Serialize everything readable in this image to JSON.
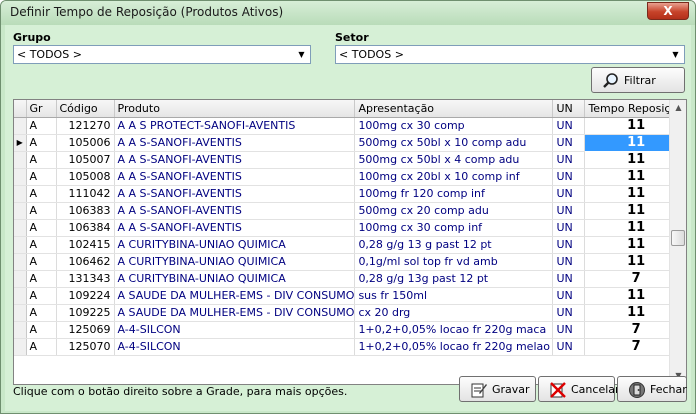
{
  "window": {
    "title": "Definir Tempo de Reposição (Produtos Ativos)",
    "close_label": "X"
  },
  "filters": {
    "grupo_label": "Grupo",
    "grupo_value": "< TODOS >",
    "setor_label": "Setor",
    "setor_value": "< TODOS >",
    "filtrar_label": "Filtrar"
  },
  "grid": {
    "columns": [
      "Gr",
      "Código",
      "Produto",
      "Apresentação",
      "UN",
      "Tempo Reposição"
    ],
    "rows": [
      {
        "gr": "A",
        "codigo": "121270",
        "produto": "A A S PROTECT-SANOFI-AVENTIS",
        "apresentacao": "100mg cx 30 comp",
        "un": "UN",
        "tempo": "11"
      },
      {
        "gr": "A",
        "codigo": "105006",
        "produto": "A A S-SANOFI-AVENTIS",
        "apresentacao": "500mg cx 50bl x 10 comp adu",
        "un": "UN",
        "tempo": "11"
      },
      {
        "gr": "A",
        "codigo": "105007",
        "produto": "A A S-SANOFI-AVENTIS",
        "apresentacao": "500mg cx 50bl x 4 comp adu",
        "un": "UN",
        "tempo": "11"
      },
      {
        "gr": "A",
        "codigo": "105008",
        "produto": "A A S-SANOFI-AVENTIS",
        "apresentacao": "100mg cx 20bl x 10 comp inf",
        "un": "UN",
        "tempo": "11"
      },
      {
        "gr": "A",
        "codigo": "111042",
        "produto": "A A S-SANOFI-AVENTIS",
        "apresentacao": "100mg fr 120 comp inf",
        "un": "UN",
        "tempo": "11"
      },
      {
        "gr": "A",
        "codigo": "106383",
        "produto": "A A S-SANOFI-AVENTIS",
        "apresentacao": "500mg cx 20 comp adu",
        "un": "UN",
        "tempo": "11"
      },
      {
        "gr": "A",
        "codigo": "106384",
        "produto": "A A S-SANOFI-AVENTIS",
        "apresentacao": "100mg cx 30 comp inf",
        "un": "UN",
        "tempo": "11"
      },
      {
        "gr": "A",
        "codigo": "102415",
        "produto": "A CURITYBINA-UNIAO QUIMICA",
        "apresentacao": "0,28 g/g 13 g past 12 pt",
        "un": "UN",
        "tempo": "11"
      },
      {
        "gr": "A",
        "codigo": "106462",
        "produto": "A CURITYBINA-UNIAO QUIMICA",
        "apresentacao": "0,1g/ml sol top fr vd amb",
        "un": "UN",
        "tempo": "11"
      },
      {
        "gr": "A",
        "codigo": "131343",
        "produto": "A CURITYBINA-UNIAO QUIMICA",
        "apresentacao": "0,28 g/g 13g past 12 pt",
        "un": "UN",
        "tempo": "7"
      },
      {
        "gr": "A",
        "codigo": "109224",
        "produto": "A SAUDE DA MULHER-EMS - DIV CONSUMO",
        "apresentacao": "sus fr 150ml",
        "un": "UN",
        "tempo": "11"
      },
      {
        "gr": "A",
        "codigo": "109225",
        "produto": "A SAUDE DA MULHER-EMS - DIV CONSUMO",
        "apresentacao": "cx 20 drg",
        "un": "UN",
        "tempo": "11"
      },
      {
        "gr": "A",
        "codigo": "125069",
        "produto": "A-4-SILCON",
        "apresentacao": "1+0,2+0,05% locao fr 220g maca",
        "un": "UN",
        "tempo": "7"
      },
      {
        "gr": "A",
        "codigo": "125070",
        "produto": "A-4-SILCON",
        "apresentacao": "1+0,2+0,05% locao fr 220g melao",
        "un": "UN",
        "tempo": "7"
      }
    ]
  },
  "status_text": "Clique com o botão direito sobre a Grade, para mais opções.",
  "buttons": {
    "gravar": "Gravar",
    "cancelar": "Cancelar",
    "fechar": "Fechar"
  },
  "icons": [
    "search-icon",
    "save-icon",
    "cancel-icon",
    "exit-icon",
    "chevron-down-icon",
    "row-pointer-icon"
  ]
}
